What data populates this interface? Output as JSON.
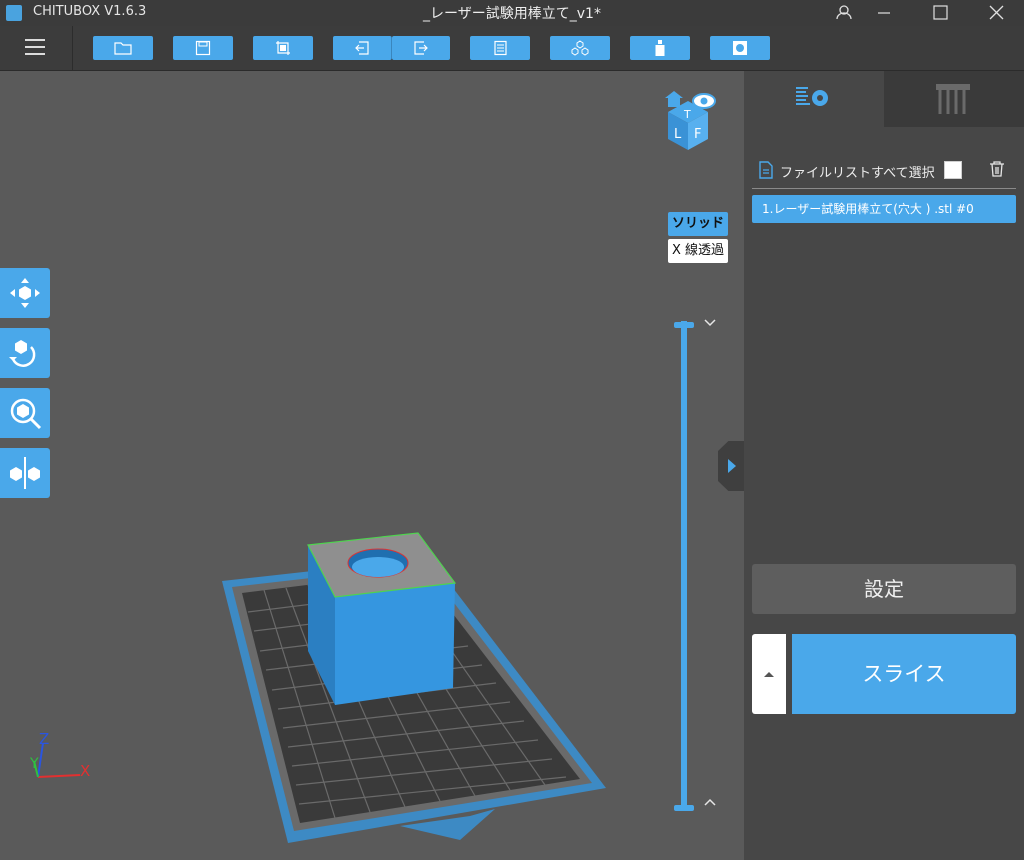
{
  "app": {
    "name": "CHITUBOX V1.6.3",
    "document_title": "_レーザー試験用棒立て_v1*"
  },
  "window_controls": [
    "user-icon",
    "minimize-icon",
    "maximize-icon",
    "close-icon"
  ],
  "toolbar": {
    "buttons": [
      "open-file-icon",
      "save-icon",
      "import-icon",
      "undo-icon",
      "redo-icon",
      "file-list-icon",
      "arrange-icon",
      "hollow-icon",
      "drill-hole-icon"
    ]
  },
  "view_cube": {
    "faces": [
      "T",
      "L",
      "F"
    ],
    "icons": [
      "home-icon",
      "eye-icon"
    ]
  },
  "side_tools": [
    "move-icon",
    "rotate-icon",
    "scale-icon",
    "mirror-icon"
  ],
  "render_mode": {
    "solid_label": "ソリッド",
    "xray_label": "X 線透過",
    "selected": "solid"
  },
  "axes": {
    "x": "X",
    "y": "Y",
    "z": "Z"
  },
  "panel": {
    "tabs": [
      "settings-tab-icon",
      "supports-tab-icon"
    ],
    "active_tab": 0,
    "select_all_label": "ファイルリストすべて選択",
    "select_all_checked": false,
    "files": [
      "1.レーザー試験用棒立て(穴大 ) .stl #0"
    ],
    "settings_label": "設定",
    "slice_label": "スライス"
  },
  "colors": {
    "accent": "#4aa8ea",
    "model_top": "#9a9a9a",
    "background": "#5a5a5a",
    "panel": "#474747"
  }
}
